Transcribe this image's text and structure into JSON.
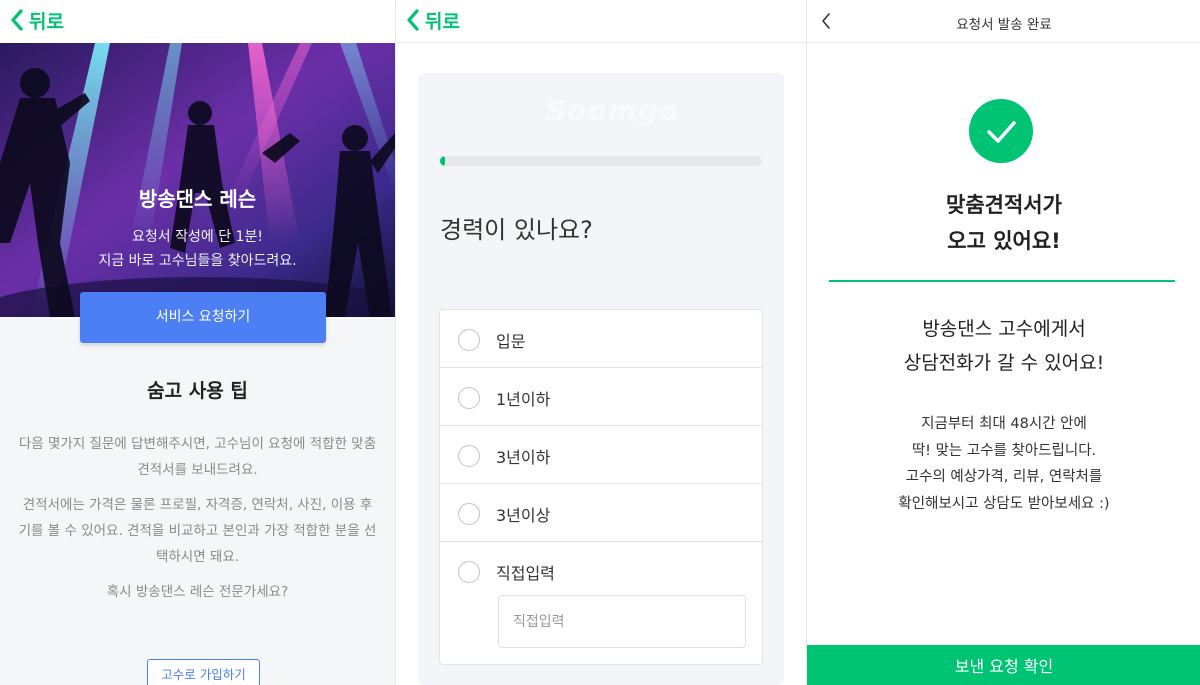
{
  "colors": {
    "brand_green": "#00c473",
    "primary_blue": "#4b7ff3",
    "muted_text": "#8a8a8a"
  },
  "panel1": {
    "back_label": "뒤로",
    "hero": {
      "title": "방송댄스 레슨",
      "subtitle_line1": "요청서 작성에 단 1분!",
      "subtitle_line2": "지금 바로 고수님들을 찾아드려요."
    },
    "service_button": "서비스 요청하기",
    "tip_title": "숨고 사용 팁",
    "tip_p1": "다음 몇가지 질문에 답변해주시면, 고수님이 요청에 적합한 맞춤 견적서를 보내드려요.",
    "tip_p2": "견적서에는 가격은 물론 프로필, 자격증, 연락처, 사진, 이용 후기를 볼 수 있어요. 견적을 비교하고 본인과 가장 적합한 분을 선택하시면 돼요.",
    "tip_p3": "혹시 방송댄스 레슨 전문가세요?",
    "signup_button": "고수로 가입하기"
  },
  "panel2": {
    "back_label": "뒤로",
    "progress": 0.01,
    "question": "경력이 있나요?",
    "options": [
      "입문",
      "1년이하",
      "3년이하",
      "3년이상",
      "직접입력"
    ],
    "direct_input_placeholder": "직접입력"
  },
  "panel3": {
    "header_title": "요청서 발송 완료",
    "heading_line1": "맞춤견적서가",
    "heading_line2": "오고 있어요!",
    "sub_line1": "방송댄스 고수에게서",
    "sub_line2": "상담전화가 갈 수 있어요!",
    "info_line1": "지금부터 최대 48시간 안에",
    "info_line2": "딱! 맞는 고수를 찾아드립니다.",
    "info_line3": "고수의 예상가격, 리뷰, 연락처를",
    "info_line4": "확인해보시고 상담도 받아보세요 :)",
    "confirm_button": "보낸 요청 확인"
  },
  "icons": {
    "back": "chevron-left-icon",
    "radio": "radio-unchecked-icon",
    "check": "check-icon"
  }
}
